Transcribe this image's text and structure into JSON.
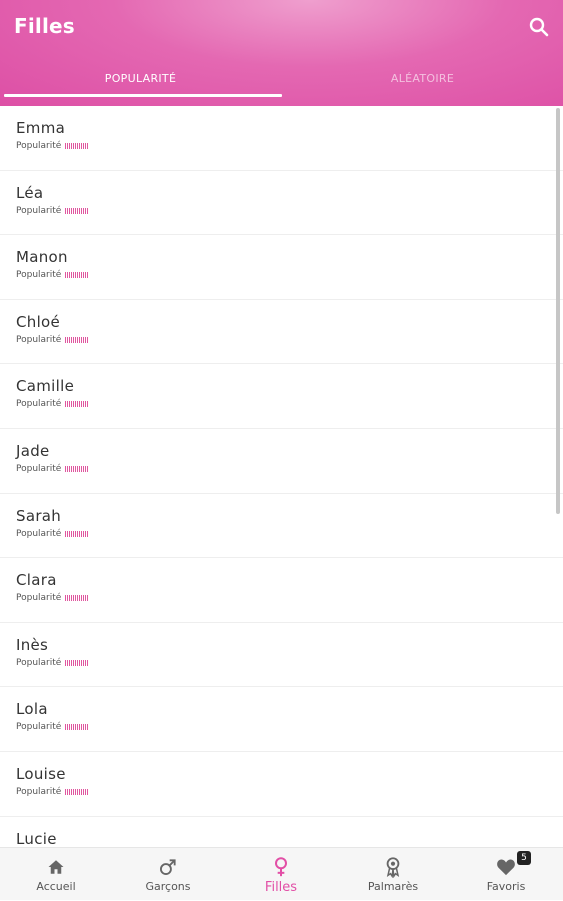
{
  "header": {
    "title": "Filles"
  },
  "tabs": [
    {
      "label": "POPULARITÉ"
    },
    {
      "label": "ALÉATOIRE"
    }
  ],
  "list": {
    "popularity_label": "Popularité",
    "items": [
      {
        "name": "Emma"
      },
      {
        "name": "Léa"
      },
      {
        "name": "Manon"
      },
      {
        "name": "Chloé"
      },
      {
        "name": "Camille"
      },
      {
        "name": "Jade"
      },
      {
        "name": "Sarah"
      },
      {
        "name": "Clara"
      },
      {
        "name": "Inès"
      },
      {
        "name": "Lola"
      },
      {
        "name": "Louise"
      },
      {
        "name": "Lucie"
      }
    ]
  },
  "bottom_nav": {
    "items": [
      {
        "label": "Accueil",
        "icon": "home-icon"
      },
      {
        "label": "Garçons",
        "icon": "male-icon"
      },
      {
        "label": "Filles",
        "icon": "female-icon"
      },
      {
        "label": "Palmarès",
        "icon": "award-icon"
      },
      {
        "label": "Favoris",
        "icon": "heart-icon",
        "badge": "5"
      }
    ]
  },
  "colors": {
    "accent": "#e24fa6",
    "appbar": "#dd4fa5"
  }
}
